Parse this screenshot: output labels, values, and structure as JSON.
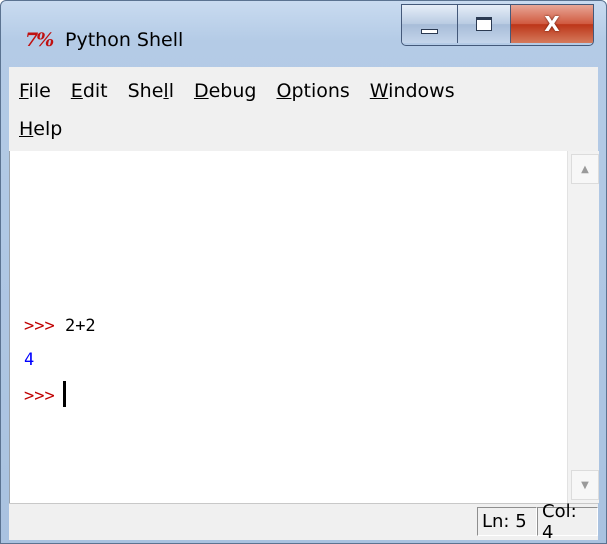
{
  "window": {
    "logo": "7%",
    "title": "Python Shell",
    "close_glyph": "X"
  },
  "menu": {
    "items": [
      {
        "pre": "",
        "acc": "F",
        "post": "ile"
      },
      {
        "pre": "",
        "acc": "E",
        "post": "dit"
      },
      {
        "pre": "She",
        "acc": "l",
        "post": "l"
      },
      {
        "pre": "",
        "acc": "D",
        "post": "ebug"
      },
      {
        "pre": "",
        "acc": "O",
        "post": "ptions"
      },
      {
        "pre": "",
        "acc": "W",
        "post": "indows"
      },
      {
        "pre": "",
        "acc": "H",
        "post": "elp"
      }
    ]
  },
  "shell": {
    "lines": [
      {
        "prompt": ">>>",
        "text": " 2+2"
      },
      {
        "output": "4"
      },
      {
        "prompt": ">>>",
        "text": ""
      }
    ]
  },
  "status": {
    "line": "Ln: 5",
    "column": "Col: 4"
  },
  "colors": {
    "prompt": "#c00000",
    "output": "#0000ff",
    "close_button": "#c63b1e"
  },
  "icons": {
    "app": "tk-feather-icon",
    "minimize": "minimize-icon",
    "maximize": "maximize-icon",
    "close": "close-icon",
    "scroll_up": "arrow-up-icon",
    "scroll_down": "arrow-down-icon"
  }
}
